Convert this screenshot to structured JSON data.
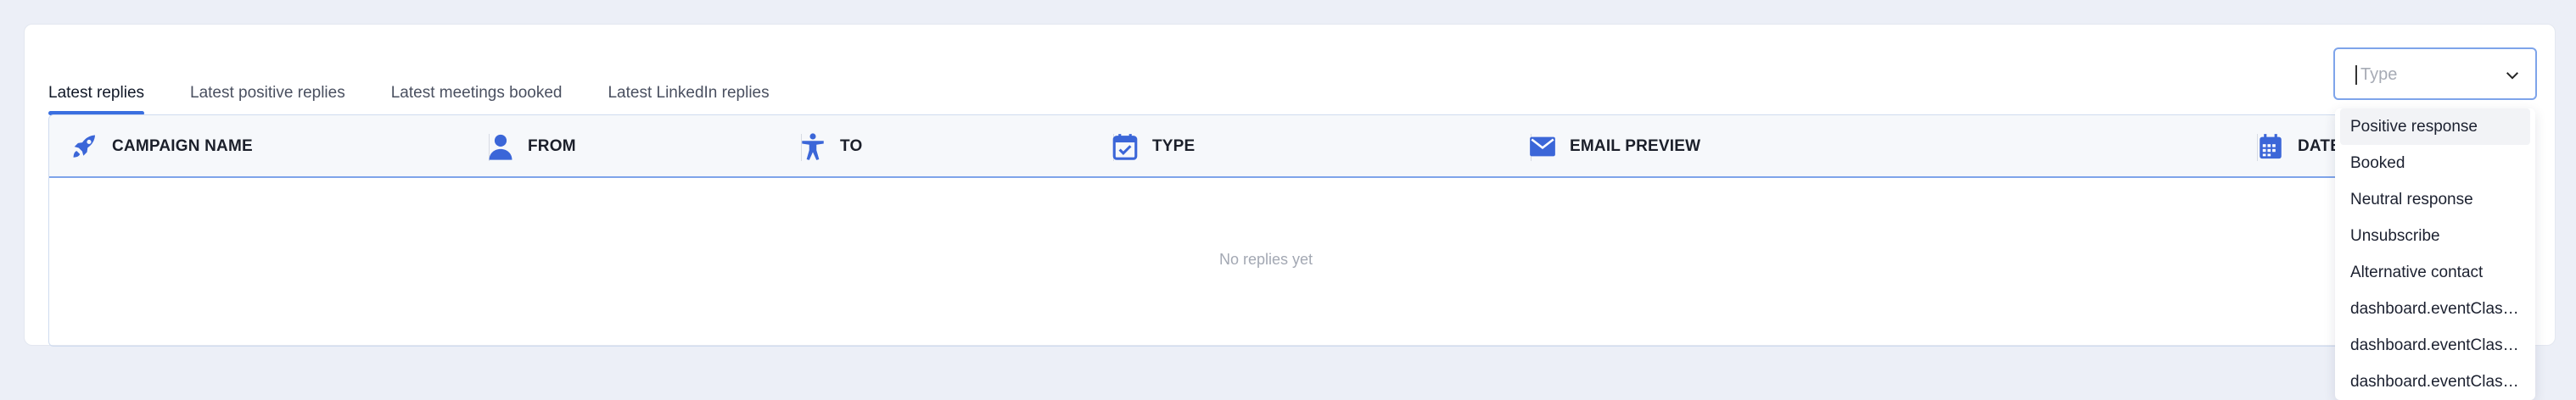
{
  "tabs": [
    {
      "label": "Latest replies",
      "active": true
    },
    {
      "label": "Latest positive replies",
      "active": false
    },
    {
      "label": "Latest meetings booked",
      "active": false
    },
    {
      "label": "Latest LinkedIn replies",
      "active": false
    }
  ],
  "table": {
    "columns": [
      {
        "label": "CAMPAIGN NAME",
        "icon": "rocket-icon"
      },
      {
        "label": "FROM",
        "icon": "person-icon"
      },
      {
        "label": "TO",
        "icon": "accessibility-person-icon"
      },
      {
        "label": "TYPE",
        "icon": "calendar-check-icon"
      },
      {
        "label": "EMAIL PREVIEW",
        "icon": "envelope-icon"
      },
      {
        "label": "DATE",
        "icon": "calendar-icon"
      }
    ],
    "empty_text": "No replies yet"
  },
  "type_filter": {
    "placeholder": "Type",
    "options": [
      "Positive response",
      "Booked",
      "Neutral response",
      "Unsubscribe",
      "Alternative contact",
      "dashboard.eventClas…",
      "dashboard.eventClas…",
      "dashboard.eventClas…"
    ]
  },
  "colors": {
    "accent": "#3a6fe0",
    "icon_blue": "#3b66d8",
    "page_bg": "#eceff7",
    "header_bg": "#f6f8fb"
  }
}
